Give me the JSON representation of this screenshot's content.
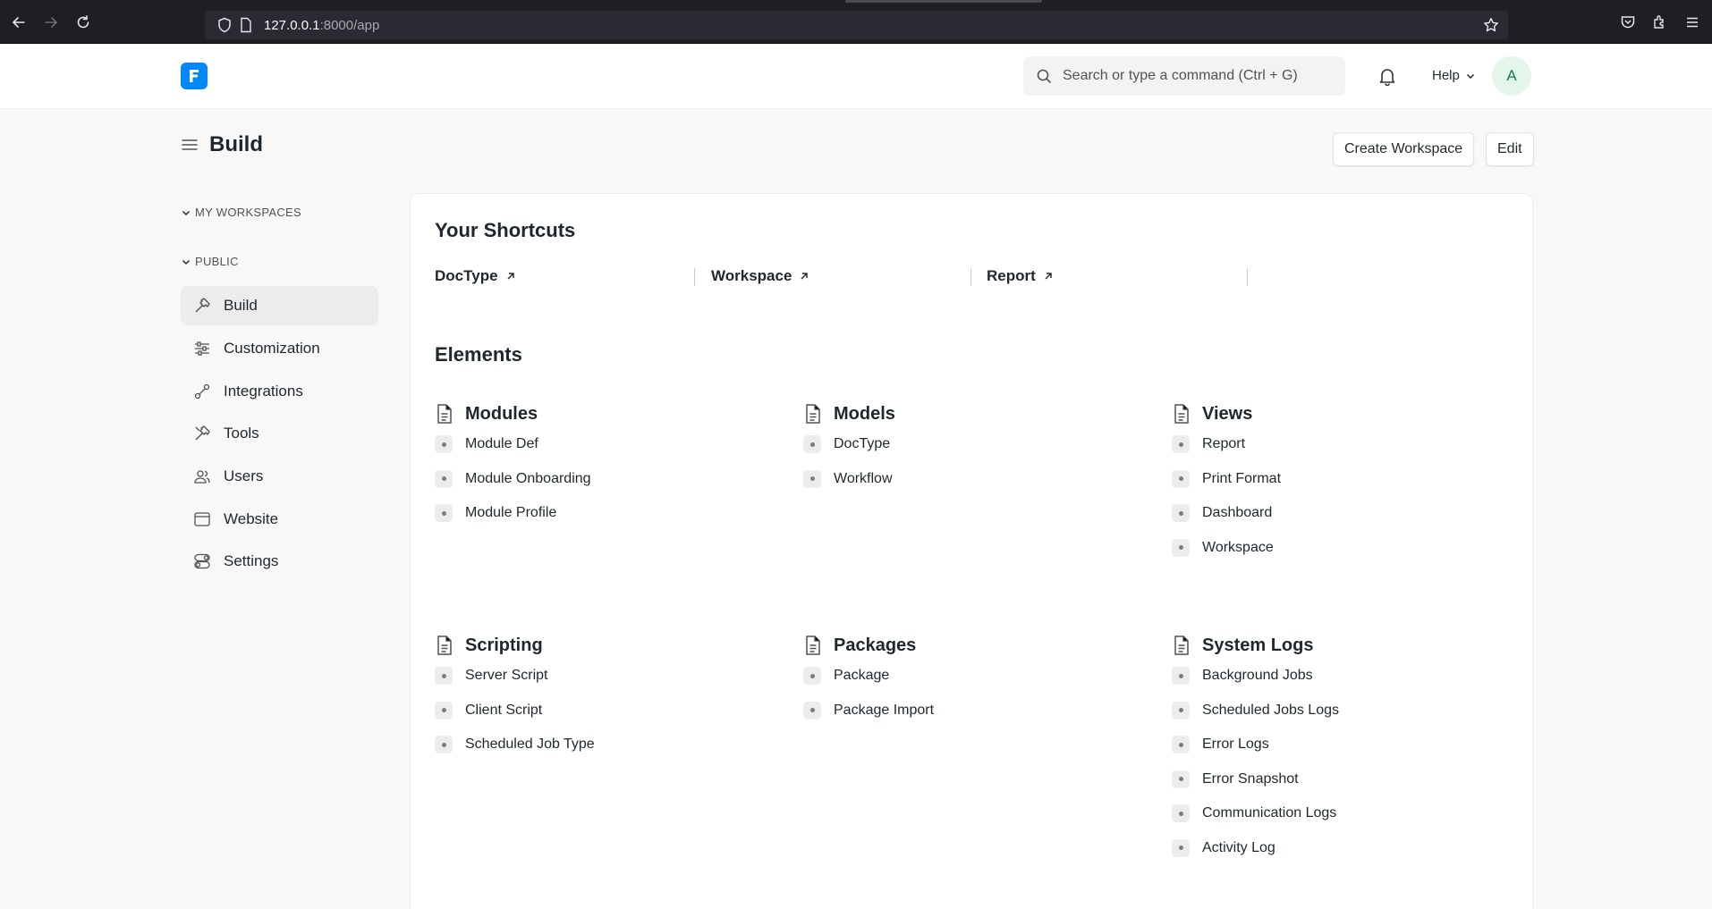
{
  "browser": {
    "url_host": "127.0.0.1",
    "url_path": ":8000/app"
  },
  "navbar": {
    "search_placeholder": "Search or type a command (Ctrl + G)",
    "help_label": "Help",
    "avatar_initial": "A"
  },
  "page": {
    "title": "Build",
    "create_workspace_label": "Create Workspace",
    "edit_label": "Edit"
  },
  "sidebar": {
    "my_workspaces_label": "MY WORKSPACES",
    "public_label": "PUBLIC",
    "items": [
      {
        "label": "Build",
        "icon": "hammer-icon",
        "active": true
      },
      {
        "label": "Customization",
        "icon": "sliders-icon",
        "active": false
      },
      {
        "label": "Integrations",
        "icon": "link-icon",
        "active": false
      },
      {
        "label": "Tools",
        "icon": "tools-icon",
        "active": false
      },
      {
        "label": "Users",
        "icon": "users-icon",
        "active": false
      },
      {
        "label": "Website",
        "icon": "browser-icon",
        "active": false
      },
      {
        "label": "Settings",
        "icon": "toggle-icon",
        "active": false
      }
    ]
  },
  "shortcuts": {
    "title": "Your Shortcuts",
    "items": [
      "DocType",
      "Workspace",
      "Report"
    ]
  },
  "elements": {
    "title": "Elements",
    "groups": [
      {
        "title": "Modules",
        "links": [
          "Module Def",
          "Module Onboarding",
          "Module Profile"
        ]
      },
      {
        "title": "Models",
        "links": [
          "DocType",
          "Workflow"
        ]
      },
      {
        "title": "Views",
        "links": [
          "Report",
          "Print Format",
          "Dashboard",
          "Workspace"
        ]
      },
      {
        "title": "Scripting",
        "links": [
          "Server Script",
          "Client Script",
          "Scheduled Job Type"
        ]
      },
      {
        "title": "Packages",
        "links": [
          "Package",
          "Package Import"
        ]
      },
      {
        "title": "System Logs",
        "links": [
          "Background Jobs",
          "Scheduled Jobs Logs",
          "Error Logs",
          "Error Snapshot",
          "Communication Logs",
          "Activity Log"
        ]
      }
    ]
  },
  "colors": {
    "brand": "#0289f7",
    "active_item_bg": "#ececec",
    "avatar_bg": "#e4f5e9"
  }
}
